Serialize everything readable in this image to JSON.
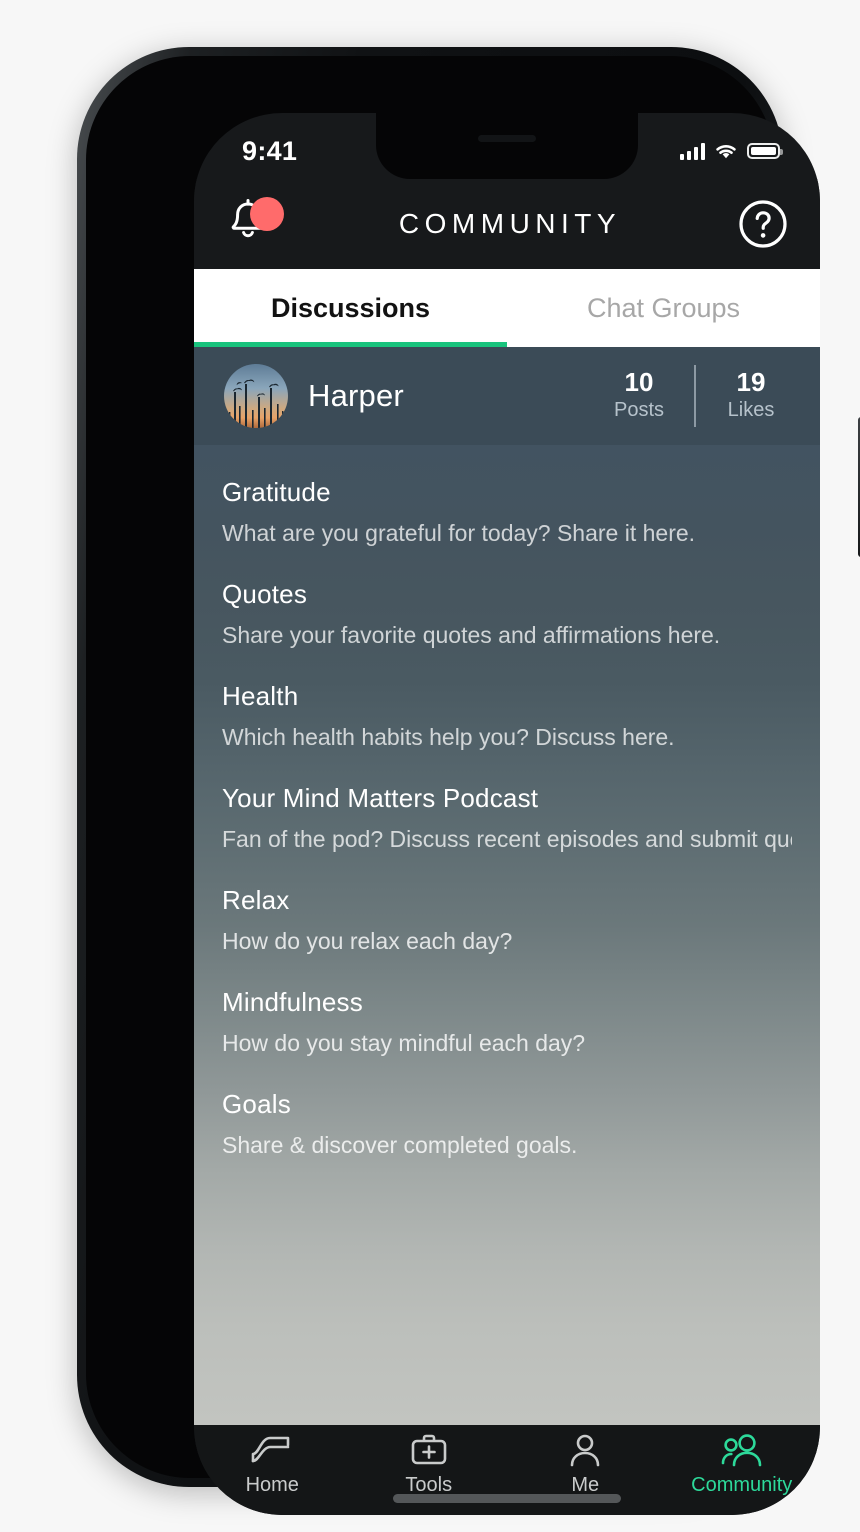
{
  "theme": {
    "accent": "#19c37d",
    "badge": "#ff6b6b",
    "header_bg": "#17191b",
    "profile_bg": "#3b4b57"
  },
  "status_bar": {
    "time": "9:41",
    "signal_icon": "cellular-signal-icon",
    "wifi_icon": "wifi-icon",
    "battery_icon": "battery-full-icon"
  },
  "app_bar": {
    "title": "COMMUNITY",
    "bell_icon": "notification-bell-icon",
    "badge_label": "",
    "help_icon": "help-circle-icon"
  },
  "tabs": [
    {
      "label": "Discussions",
      "active": true
    },
    {
      "label": "Chat Groups",
      "active": false
    }
  ],
  "profile": {
    "avatar_icon": "palm-trees-sunset-avatar",
    "username": "Harper",
    "stats": [
      {
        "value": "10",
        "label": "Posts"
      },
      {
        "value": "19",
        "label": "Likes"
      }
    ]
  },
  "discussions": [
    {
      "title": "Gratitude",
      "subtitle": "What are you grateful for today? Share it here."
    },
    {
      "title": "Quotes",
      "subtitle": "Share your favorite quotes and affirmations here."
    },
    {
      "title": "Health",
      "subtitle": "Which health habits help you? Discuss here."
    },
    {
      "title": "Your Mind Matters Podcast",
      "subtitle": "Fan of the pod? Discuss recent episodes and submit questi…"
    },
    {
      "title": "Relax",
      "subtitle": "How do you relax each day?"
    },
    {
      "title": "Mindfulness",
      "subtitle": "How do you stay mindful each day?"
    },
    {
      "title": "Goals",
      "subtitle": "Share & discover completed goals."
    }
  ],
  "bottom_nav": [
    {
      "label": "Home",
      "icon": "path-curve-icon",
      "active": false
    },
    {
      "label": "Tools",
      "icon": "toolbox-plus-icon",
      "active": false
    },
    {
      "label": "Me",
      "icon": "person-icon",
      "active": false
    },
    {
      "label": "Community",
      "icon": "people-group-icon",
      "active": true
    }
  ]
}
